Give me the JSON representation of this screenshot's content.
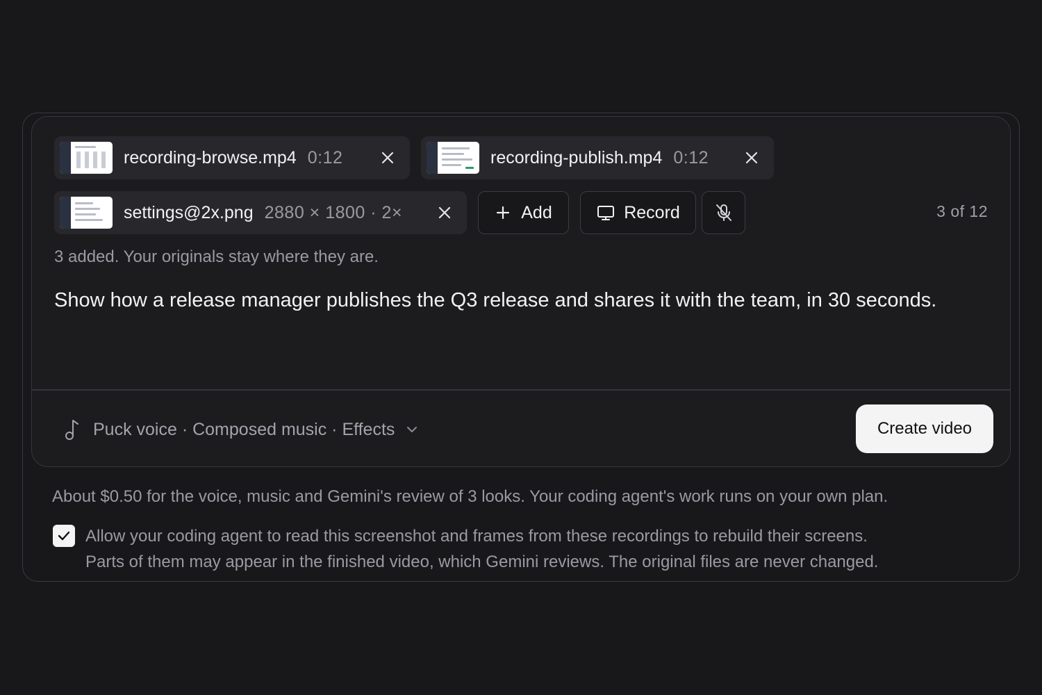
{
  "attachments": [
    {
      "name": "recording-browse.mp4",
      "meta": "0:12",
      "remove_icon": "close-icon"
    },
    {
      "name": "recording-publish.mp4",
      "meta": "0:12",
      "remove_icon": "close-icon"
    },
    {
      "name": "settings@2x.png",
      "meta": "2880 × 1800 · 2×",
      "remove_icon": "close-icon"
    }
  ],
  "buttons": {
    "add": {
      "label": "Add",
      "icon": "plus-icon"
    },
    "record": {
      "label": "Record",
      "icon": "monitor-icon"
    },
    "mic": {
      "icon": "mic-off-icon"
    }
  },
  "counter": "3 of 12",
  "added_note": "3 added. Your originals stay where they are.",
  "prompt": "Show how a release manager publishes the Q3 release and shares it with the team, in 30 seconds.",
  "audio": {
    "label": "Puck voice · Composed music · Effects",
    "icon": "music-note-icon",
    "dropdown_icon": "chevron-down-icon"
  },
  "create_button": "Create video",
  "cost_note": "About $0.50 for the voice, music and Gemini's review of 3 looks. Your coding agent's work runs on your own plan.",
  "consent": {
    "checked": true,
    "line1": "Allow your coding agent to read this screenshot and frames from these recordings to rebuild their screens.",
    "line2": "Parts of them may appear in the finished video, which Gemini reviews. The original files are never changed."
  },
  "colors": {
    "background": "#18181b",
    "surface": "#1c1c1f",
    "chip": "#28282c",
    "primary_button": "#f4f4f5"
  }
}
